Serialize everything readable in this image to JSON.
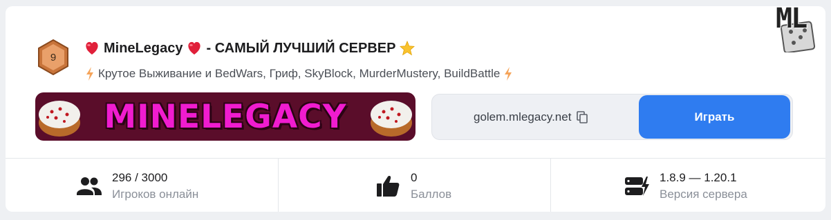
{
  "server": {
    "rank": "9",
    "name": "MineLegacy",
    "title_suffix": "- САМЫЙ ЛУЧШИЙ СЕРВЕР",
    "subtitle": "Крутое Выживание и BedWars, Гриф, SkyBlock, MurderMustery, BuildBattle",
    "banner_text": "MINELEGACY",
    "ip": "golem.mlegacy.net",
    "play_label": "Играть"
  },
  "stats": [
    {
      "value": "296 / 3000",
      "label": "Игроков онлайн",
      "icon": "users-icon"
    },
    {
      "value": "0",
      "label": "Баллов",
      "icon": "thumbs-up-icon"
    },
    {
      "value": "1.8.9 — 1.20.1",
      "label": "Версия сервера",
      "icon": "server-icon"
    }
  ],
  "logo": {
    "text": "ML"
  },
  "colors": {
    "accent": "#2f7cf0",
    "banner_bg": "#5a0d2a",
    "banner_text": "#f01ccf",
    "rank_badge": "#c8743a"
  }
}
